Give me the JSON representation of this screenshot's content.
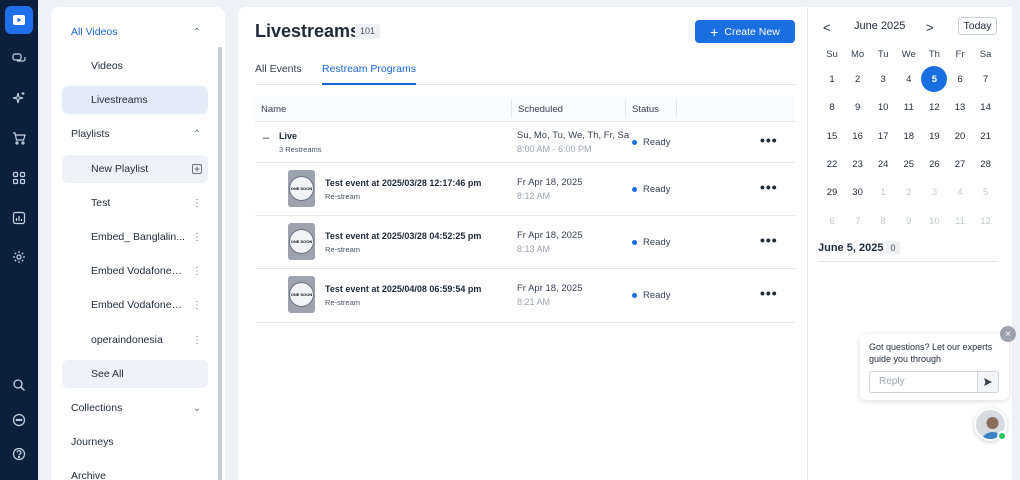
{
  "rail": {
    "items": [
      {
        "icon": "video-play-icon",
        "active": true
      },
      {
        "icon": "chat-bubbles-icon"
      },
      {
        "icon": "sparkle-icon"
      },
      {
        "icon": "cart-icon"
      },
      {
        "icon": "grid-icon"
      },
      {
        "icon": "analytics-icon"
      },
      {
        "icon": "gear-icon"
      }
    ],
    "bottom": [
      {
        "icon": "search-icon"
      },
      {
        "icon": "chat-dots-icon"
      },
      {
        "icon": "help-icon"
      }
    ]
  },
  "sidenav": {
    "all_videos": "All Videos",
    "videos": "Videos",
    "livestreams": "Livestreams",
    "playlists": "Playlists",
    "new_playlist": "New Playlist",
    "playlist_items": [
      "Test",
      "Embed_ Banglalin...",
      "Embed Vodafone_...",
      "Embed Vodafone_...",
      "operaindonesia"
    ],
    "see_all": "See All",
    "collections": "Collections",
    "journeys": "Journeys",
    "archive": "Archive"
  },
  "main": {
    "title": "Livestreams",
    "count": "101",
    "create_label": "Create New",
    "tabs": [
      "All Events",
      "Restream Programs"
    ],
    "active_tab": 1,
    "columns": [
      "Name",
      "Scheduled",
      "Status"
    ],
    "group": {
      "name": "Live",
      "sub": "3 Restreams",
      "sched_days": "Su, Mo, Tu, We, Th, Fr, Sa",
      "sched_time": "8:00 AM - 6:00 PM",
      "status": "Ready"
    },
    "events": [
      {
        "title": "Test event at 2025/03/28 12:17:46 pm",
        "sub": "Re-stream",
        "date": "Fr Apr 18, 2025",
        "time": "8:12 AM",
        "status": "Ready",
        "thumb_text": "ONE SOON"
      },
      {
        "title": "Test event at 2025/03/28 04:52:25 pm",
        "sub": "Re-stream",
        "date": "Fr Apr 18, 2025",
        "time": "8:13 AM",
        "status": "Ready",
        "thumb_text": "ONE SOON"
      },
      {
        "title": "Test event at 2025/04/08 06:59:54 pm",
        "sub": "Re-stream",
        "date": "Fr Apr 18, 2025",
        "time": "8:21 AM",
        "status": "Ready",
        "thumb_text": "ONE SOON"
      }
    ]
  },
  "calendar": {
    "month": "June 2025",
    "today_label": "Today",
    "prev": "<",
    "next": ">",
    "weekdays": [
      "Su",
      "Mo",
      "Tu",
      "We",
      "Th",
      "Fr",
      "Sa"
    ],
    "weeks": [
      [
        "1",
        "2",
        "3",
        "4",
        "5",
        "6",
        "7"
      ],
      [
        "8",
        "9",
        "10",
        "11",
        "12",
        "13",
        "14"
      ],
      [
        "15",
        "16",
        "17",
        "18",
        "19",
        "20",
        "21"
      ],
      [
        "22",
        "23",
        "24",
        "25",
        "26",
        "27",
        "28"
      ],
      [
        "29",
        "30",
        "1",
        "2",
        "3",
        "4",
        "5"
      ],
      [
        "6",
        "7",
        "8",
        "9",
        "10",
        "11",
        "12"
      ]
    ],
    "selected_day": "5",
    "selected_label": "June 5, 2025",
    "selected_count": "0"
  },
  "chat": {
    "message": "Got questions? Let our experts guide you through",
    "placeholder": "Reply"
  },
  "colors": {
    "accent": "#1a6fe0",
    "rail_bg": "#0c1f3d",
    "online": "#22c55e"
  }
}
